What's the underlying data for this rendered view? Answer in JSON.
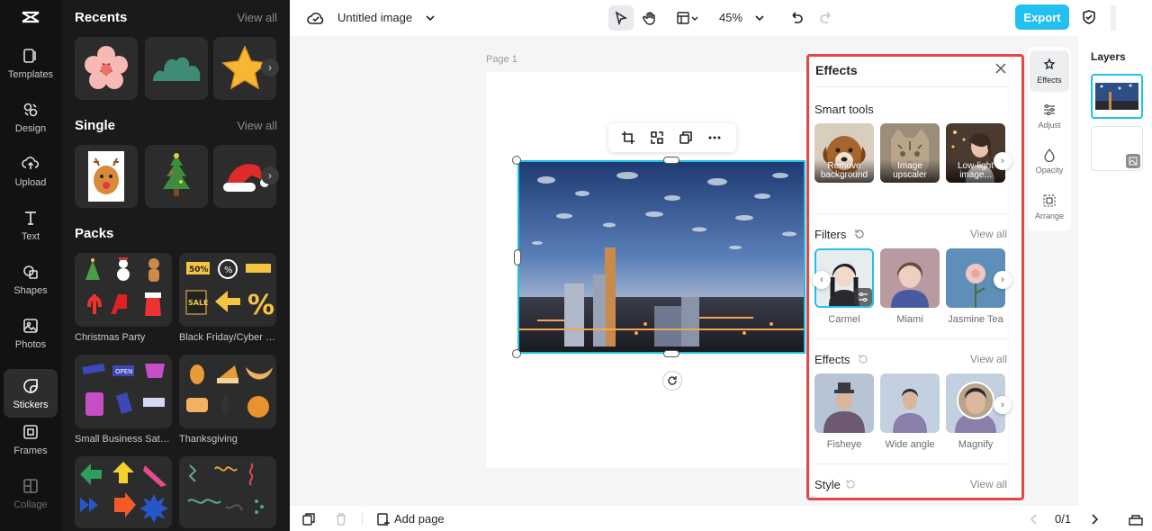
{
  "rail": {
    "items": [
      {
        "label": "Templates",
        "icon": "templates-icon"
      },
      {
        "label": "Design",
        "icon": "design-icon"
      },
      {
        "label": "Upload",
        "icon": "upload-icon"
      },
      {
        "label": "Text",
        "icon": "text-icon"
      },
      {
        "label": "Shapes",
        "icon": "shapes-icon"
      },
      {
        "label": "Photos",
        "icon": "photos-icon"
      },
      {
        "label": "Stickers",
        "icon": "stickers-icon"
      },
      {
        "label": "Frames",
        "icon": "frames-icon"
      },
      {
        "label": "Collage",
        "icon": "collage-icon"
      }
    ],
    "active": "Stickers"
  },
  "stickers": {
    "recents_title": "Recents",
    "single_title": "Single",
    "packs_title": "Packs",
    "view_all": "View all",
    "packs": [
      {
        "label": "Christmas Party"
      },
      {
        "label": "Black Friday/Cyber M..."
      },
      {
        "label": "Small Business Saturd..."
      },
      {
        "label": "Thanksgiving"
      }
    ]
  },
  "topbar": {
    "title": "Untitled image",
    "zoom": "45%",
    "export_label": "Export"
  },
  "canvas": {
    "page_label": "Page 1"
  },
  "effects_panel": {
    "title": "Effects",
    "smart_tools": {
      "heading": "Smart tools",
      "items": [
        {
          "line1": "Remove",
          "line2": "background"
        },
        {
          "line1": "Image",
          "line2": "upscaler"
        },
        {
          "line1": "Low-light",
          "line2": "image..."
        }
      ]
    },
    "filters": {
      "heading": "Filters",
      "view_all": "View all",
      "items": [
        "Carmel",
        "Miami",
        "Jasmine Tea"
      ]
    },
    "effects": {
      "heading": "Effects",
      "view_all": "View all",
      "items": [
        "Fisheye",
        "Wide angle",
        "Magnify"
      ]
    },
    "style": {
      "heading": "Style",
      "view_all": "View all"
    }
  },
  "right_tabs": [
    {
      "label": "Effects"
    },
    {
      "label": "Adjust"
    },
    {
      "label": "Opacity"
    },
    {
      "label": "Arrange"
    }
  ],
  "layers": {
    "title": "Layers"
  },
  "bottombar": {
    "add_page": "Add page",
    "page_counter": "0/1"
  },
  "colors": {
    "accent": "#21c0ee",
    "selection": "#1bc0e6",
    "highlight_border": "#e54545"
  }
}
